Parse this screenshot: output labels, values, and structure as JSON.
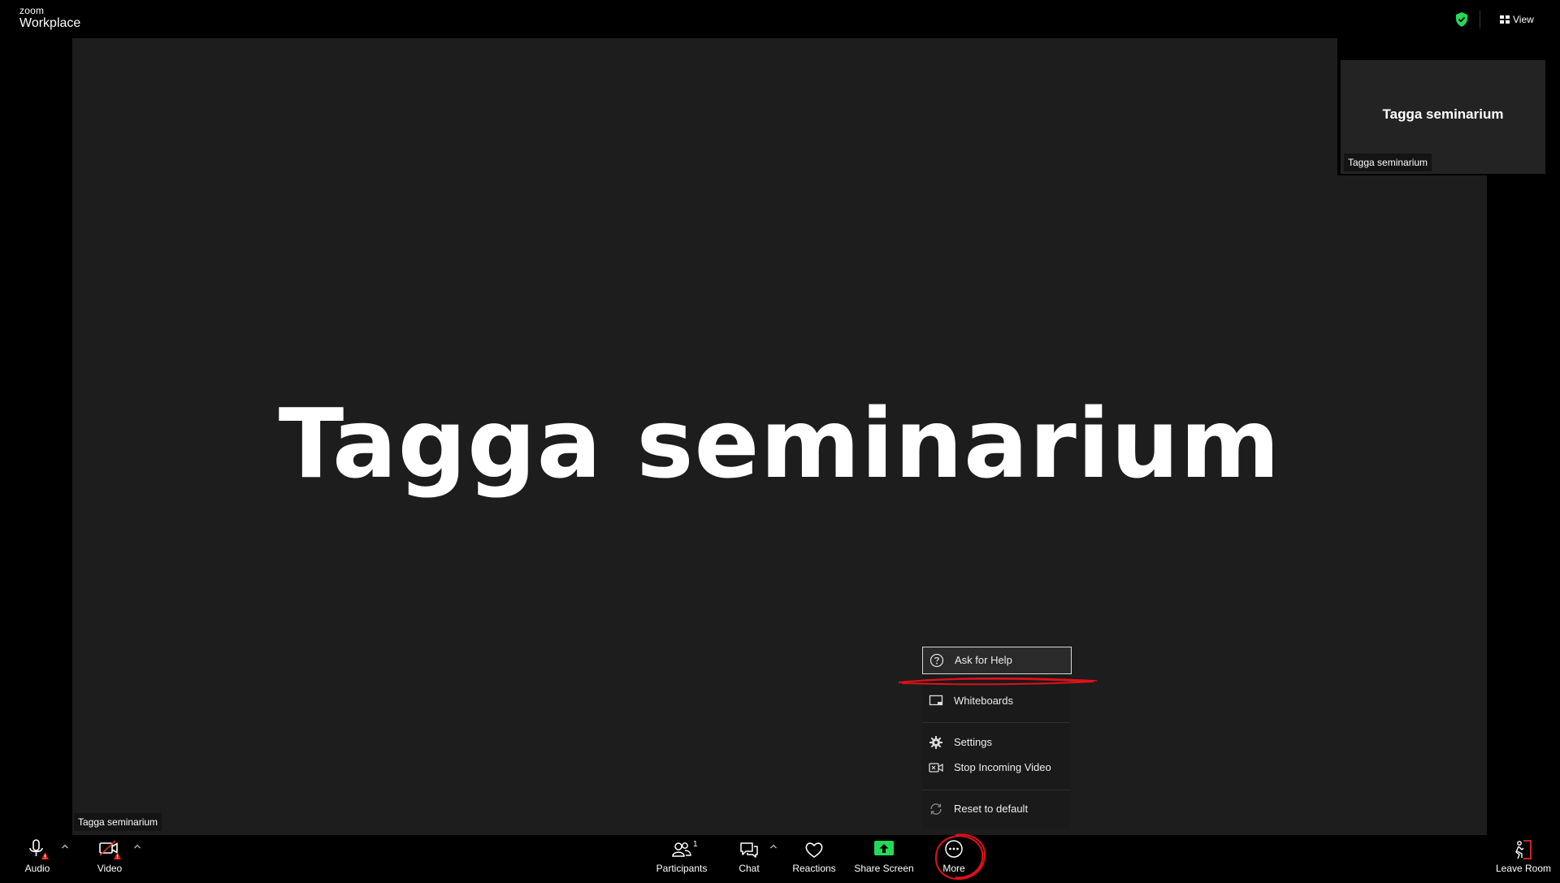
{
  "app": {
    "logo_top": "zoom",
    "logo_bottom": "Workplace"
  },
  "topbar": {
    "security_icon": "shield-check-icon",
    "security_color": "#23d959",
    "view_label": "View",
    "view_icon": "grid-icon"
  },
  "stage": {
    "title": "Tagga seminarium",
    "name_tag": "Tagga seminarium"
  },
  "thumbnail": {
    "title": "Tagga seminarium",
    "name_tag": "Tagga seminarium"
  },
  "more_menu": {
    "items": [
      {
        "label": "Ask for Help",
        "icon": "question-circle-icon"
      },
      {
        "label": "Whiteboards",
        "icon": "whiteboard-icon"
      },
      {
        "label": "Settings",
        "icon": "gear-icon"
      },
      {
        "label": "Stop Incoming Video",
        "icon": "video-stop-icon"
      },
      {
        "label": "Reset to default",
        "icon": "reset-icon"
      }
    ]
  },
  "toolbar": {
    "audio_label": "Audio",
    "video_label": "Video",
    "participants_label": "Participants",
    "participants_count": "1",
    "chat_label": "Chat",
    "reactions_label": "Reactions",
    "share_label": "Share Screen",
    "share_color": "#23d959",
    "more_label": "More",
    "leave_label": "Leave Room",
    "warning_color": "#e02828"
  },
  "annotation_color": "#e0101a"
}
